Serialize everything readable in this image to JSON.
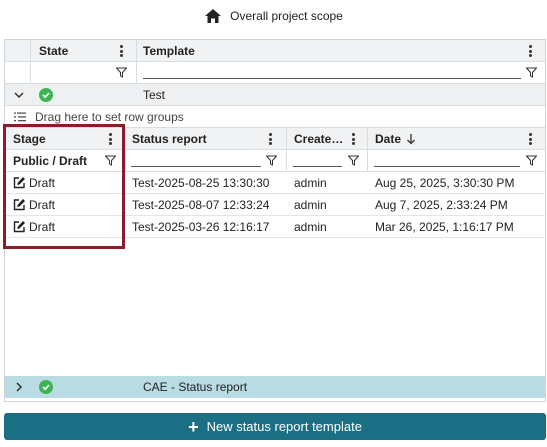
{
  "scope": {
    "label": "Overall project scope",
    "icon": "home-icon"
  },
  "outer_grid": {
    "columns": [
      {
        "key": "state",
        "label": "State"
      },
      {
        "key": "template",
        "label": "Template"
      }
    ]
  },
  "groups": [
    {
      "name": "Test",
      "expanded": true,
      "status": "ok"
    },
    {
      "name": "CAE - Status report",
      "expanded": false,
      "status": "ok"
    }
  ],
  "drag_hint": "Drag here to set row groups",
  "inner_grid": {
    "columns": [
      {
        "key": "stage",
        "label": "Stage"
      },
      {
        "key": "status_report",
        "label": "Status report"
      },
      {
        "key": "created_by",
        "label": "Create…"
      },
      {
        "key": "date",
        "label": "Date",
        "sort": "descending"
      }
    ],
    "stage_filter_value": "Public / Draft",
    "rows": [
      {
        "stage": "Draft",
        "status_report": "Test-2025-08-25 13:30:30",
        "created_by": "admin",
        "date": "Aug 25, 2025, 3:30:30 PM"
      },
      {
        "stage": "Draft",
        "status_report": "Test-2025-08-07 12:33:24",
        "created_by": "admin",
        "date": "Aug 7, 2025, 2:33:24 PM"
      },
      {
        "stage": "Draft",
        "status_report": "Test-2025-03-26 12:16:17",
        "created_by": "admin",
        "date": "Mar 26, 2025, 1:16:17 PM"
      }
    ]
  },
  "new_button": {
    "label": "New status report template",
    "icon": "plus-icon"
  },
  "colors": {
    "accent": "#1a6f85",
    "highlight": "#8c1c2c",
    "success": "#3bb552",
    "collapsed_group_bg": "#b9dbe4"
  }
}
